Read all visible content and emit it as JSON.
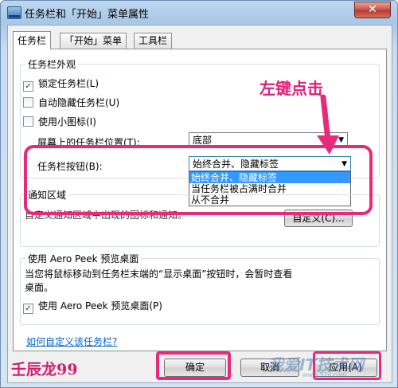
{
  "window": {
    "title": "任务栏和「开始」菜单属性",
    "close": "✕"
  },
  "tabs": [
    "任务栏",
    "「开始」菜单",
    "工具栏"
  ],
  "appearance": {
    "legend": "任务栏外观",
    "lock_taskbar": {
      "label": "锁定任务栏(L)",
      "checked": true
    },
    "auto_hide": {
      "label": "自动隐藏任务栏(U)",
      "checked": false
    },
    "small_icons": {
      "label": "使用小图标(I)",
      "checked": false
    },
    "location_label": "屏幕上的任务栏位置(T):",
    "location_value": "底部",
    "buttons_label": "任务栏按钮(B):",
    "buttons_value": "始终合并、隐藏标签",
    "buttons_options": [
      "始终合并、隐藏标签",
      "当任务栏被占满时合并",
      "从不合并"
    ]
  },
  "notification": {
    "legend": "通知区域",
    "text": "自定义通知区域中出现的图标和通知。",
    "customize": "自定义(C)..."
  },
  "aero": {
    "legend": "使用 Aero Peek 预览桌面",
    "desc_line1": "当您将鼠标移动到任务栏末端的“显示桌面”按钮时，会暂时查看",
    "desc_line2": "桌面。",
    "checkbox": {
      "label": "使用 Aero Peek 预览桌面(P)",
      "checked": true
    }
  },
  "help_link": "如何自定义该任务栏?",
  "buttons": {
    "ok": "确定",
    "cancel": "取消",
    "apply": "应用(A)"
  },
  "annotation": {
    "text": "左键点击",
    "color": "#e82a7a"
  },
  "signature": "壬辰龙99",
  "watermark": {
    "main": "我爱IT技术网",
    "sub": "www.52ij.com"
  }
}
